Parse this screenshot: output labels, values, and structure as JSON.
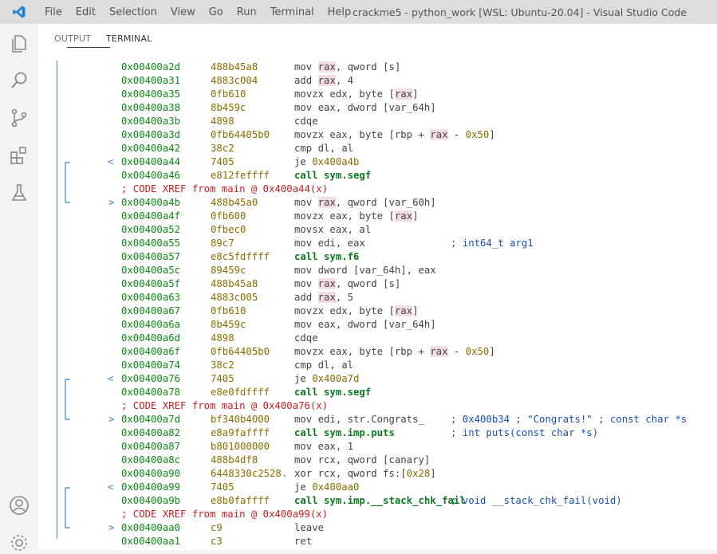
{
  "menu": [
    "File",
    "Edit",
    "Selection",
    "View",
    "Go",
    "Run",
    "Terminal",
    "Help"
  ],
  "window_title": "crackme5 - python_work [WSL: Ubuntu-20.04] - Visual Studio Code",
  "tabs": {
    "output": "OUTPUT",
    "terminal": "TERMINAL"
  },
  "colors": {
    "accent": "#007acc",
    "address": "#0e8a16",
    "bytes": "#8a6d00",
    "xref": "#c82020",
    "comment": "#1a4fb5",
    "arrow": "#3a86c8"
  },
  "lines": [
    {
      "addr": "0x00400a2d",
      "bytes": "488b45a8",
      "ins": "mov rax, qword [s]"
    },
    {
      "addr": "0x00400a31",
      "bytes": "4883c004",
      "ins": "add rax, 4"
    },
    {
      "addr": "0x00400a35",
      "bytes": "0fb610",
      "ins": "movzx edx, byte [rax]"
    },
    {
      "addr": "0x00400a38",
      "bytes": "8b459c",
      "ins": "mov eax, dword [var_64h]"
    },
    {
      "addr": "0x00400a3b",
      "bytes": "4898",
      "ins": "cdqe"
    },
    {
      "addr": "0x00400a3d",
      "bytes": "0fb64405b0",
      "ins": "movzx eax, byte [rbp + rax - 0x50]"
    },
    {
      "addr": "0x00400a42",
      "bytes": "38c2",
      "ins": "cmp dl, al"
    },
    {
      "addr": "0x00400a44",
      "bytes": "7405",
      "ins": "je 0x400a4b"
    },
    {
      "addr": "0x00400a46",
      "bytes": "e812feffff",
      "ins": "call sym.segf"
    },
    {
      "xref": "; CODE XREF from main @ 0x400a44(x)"
    },
    {
      "addr": "0x00400a4b",
      "bytes": "488b45a0",
      "ins": "mov rax, qword [var_60h]"
    },
    {
      "addr": "0x00400a4f",
      "bytes": "0fb600",
      "ins": "movzx eax, byte [rax]"
    },
    {
      "addr": "0x00400a52",
      "bytes": "0fbec0",
      "ins": "movsx eax, al"
    },
    {
      "addr": "0x00400a55",
      "bytes": "89c7",
      "ins": "mov edi, eax",
      "comment": "; int64_t arg1"
    },
    {
      "addr": "0x00400a57",
      "bytes": "e8c5fdffff",
      "ins": "call sym.f6"
    },
    {
      "addr": "0x00400a5c",
      "bytes": "89459c",
      "ins": "mov dword [var_64h], eax"
    },
    {
      "addr": "0x00400a5f",
      "bytes": "488b45a8",
      "ins": "mov rax, qword [s]"
    },
    {
      "addr": "0x00400a63",
      "bytes": "4883c005",
      "ins": "add rax, 5"
    },
    {
      "addr": "0x00400a67",
      "bytes": "0fb610",
      "ins": "movzx edx, byte [rax]"
    },
    {
      "addr": "0x00400a6a",
      "bytes": "8b459c",
      "ins": "mov eax, dword [var_64h]"
    },
    {
      "addr": "0x00400a6d",
      "bytes": "4898",
      "ins": "cdqe"
    },
    {
      "addr": "0x00400a6f",
      "bytes": "0fb64405b0",
      "ins": "movzx eax, byte [rbp + rax - 0x50]"
    },
    {
      "addr": "0x00400a74",
      "bytes": "38c2",
      "ins": "cmp dl, al"
    },
    {
      "addr": "0x00400a76",
      "bytes": "7405",
      "ins": "je 0x400a7d"
    },
    {
      "addr": "0x00400a78",
      "bytes": "e8e0fdffff",
      "ins": "call sym.segf"
    },
    {
      "xref": "; CODE XREF from main @ 0x400a76(x)"
    },
    {
      "addr": "0x00400a7d",
      "bytes": "bf340b4000",
      "ins": "mov edi, str.Congrats_",
      "comment": "; 0x400b34 ; \"Congrats!\" ; const char *s"
    },
    {
      "addr": "0x00400a82",
      "bytes": "e8a9faffff",
      "ins": "call sym.imp.puts",
      "comment": "; int puts(const char *s)"
    },
    {
      "addr": "0x00400a87",
      "bytes": "b801000000",
      "ins": "mov eax, 1"
    },
    {
      "addr": "0x00400a8c",
      "bytes": "488b4df8",
      "ins": "mov rcx, qword [canary]"
    },
    {
      "addr": "0x00400a90",
      "bytes": "6448330c2528.",
      "ins": "xor rcx, qword fs:[0x28]"
    },
    {
      "addr": "0x00400a99",
      "bytes": "7405",
      "ins": "je 0x400aa0"
    },
    {
      "addr": "0x00400a9b",
      "bytes": "e8b0faffff",
      "ins": "call sym.imp.__stack_chk_fail",
      "comment": "; void __stack_chk_fail(void)"
    },
    {
      "xref": "; CODE XREF from main @ 0x400a99(x)"
    },
    {
      "addr": "0x00400aa0",
      "bytes": "c9",
      "ins": "leave"
    },
    {
      "addr": "0x00400aa1",
      "bytes": "c3",
      "ins": "ret"
    }
  ]
}
